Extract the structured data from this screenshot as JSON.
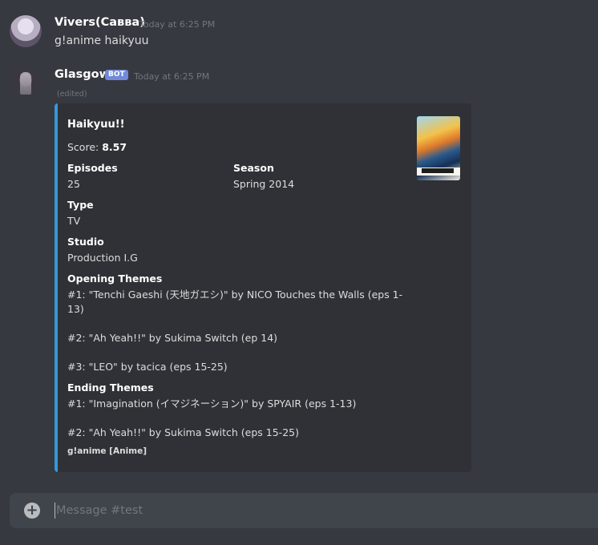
{
  "messages": [
    {
      "author": "Vivers(Савва)",
      "timestamp": "Today at 6:25 PM",
      "content": "g!anime haikyuu"
    },
    {
      "author": "Glasgow",
      "bot_tag": "BOT",
      "timestamp": "Today at 6:25 PM",
      "edited": "(edited)",
      "embed": {
        "accent_color": "#3498db",
        "title": "Haikyuu!!",
        "score_label": "Score:",
        "score_value": "8.57",
        "episodes_label": "Episodes",
        "episodes_value": "25",
        "season_label": "Season",
        "season_value": "Spring 2014",
        "type_label": "Type",
        "type_value": "TV",
        "studio_label": "Studio",
        "studio_value": "Production I.G",
        "opening_label": "Opening Themes",
        "openings": [
          "#1: \"Tenchi Gaeshi (天地ガエシ)\" by NICO Touches the Walls (eps 1-",
          "13)",
          "#2: \"Ah Yeah!!\" by Sukima Switch (ep 14)",
          "#3: \"LEO\" by tacica (eps 15-25)"
        ],
        "ending_label": "Ending Themes",
        "endings": [
          "#1: \"Imagination (イマジネーション)\" by SPYAIR (eps 1-13)",
          "#2: \"Ah Yeah!!\" by Sukima Switch (eps 15-25)"
        ],
        "footer": "g!anime [Anime]"
      }
    }
  ],
  "composer": {
    "placeholder": "Message #test",
    "add_icon": "plus-circle-icon"
  },
  "colors": {
    "background": "#36393f",
    "embed_bg": "#2f3136",
    "bot_tag": "#7289da",
    "composer_bg": "#40444b"
  }
}
